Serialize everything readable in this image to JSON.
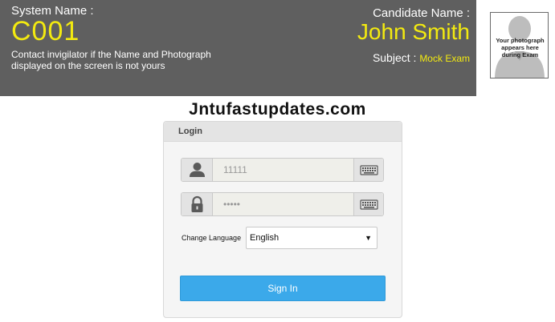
{
  "header": {
    "system_label": "System Name :",
    "system_value": "C001",
    "contact_note": "Contact invigilator if the Name and Photograph displayed on the screen is not yours",
    "candidate_label": "Candidate Name :",
    "candidate_value": "John Smith",
    "subject_label": "Subject :",
    "subject_value": "Mock Exam",
    "photo_placeholder": "Your photograph appears here during Exam"
  },
  "site_title": "Jntufastupdates.com",
  "login": {
    "title": "Login",
    "username_placeholder": "11111",
    "password_placeholder": "•••••",
    "language_label": "Change Language",
    "language_selected": "English",
    "signin_label": "Sign In"
  },
  "colors": {
    "header_bg": "#5f5f5f",
    "highlight": "#f3ea10",
    "button": "#3ba9ea"
  },
  "icons": {
    "user": "user-icon",
    "lock": "lock-icon",
    "keyboard": "keyboard-icon",
    "caret": "caret-down-icon"
  }
}
